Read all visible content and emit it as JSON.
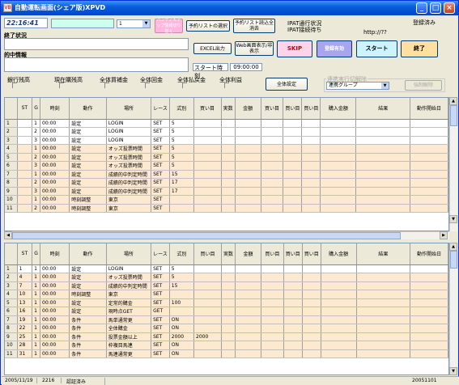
{
  "window": {
    "title": "自動運転画面(シェア版)XPVD",
    "icon": "app-icon",
    "buttons": [
      "minimize",
      "maximize",
      "close"
    ]
  },
  "top": {
    "time": "22:16:41",
    "end_status_label": "終了状況",
    "race_info_label": "的中情報",
    "combo_value": "1",
    "disabled_button": "ハンディキャップ情報切り替え",
    "select_list_button": "予約リストの選択",
    "reserve_list_button": "予約リスト読込全消去",
    "ipat_status_label": "IPAT通行状況",
    "ipat_connect_label": "IPAT接続待ち",
    "http_value": "http://??",
    "registered_label": "登録済み",
    "excel_button": "EXCEL出力",
    "web_button": "Web画面表示/非表示",
    "skip_button": "SKIP",
    "shoukai_button": "登録有効",
    "start_button": "スタート",
    "end_button": "終了",
    "start_time_label": "スタート時刻",
    "start_time_value": "09:00:00"
  },
  "options": {
    "labels": [
      "銀行残高",
      "現在購残高",
      "全体買補金",
      "全体回金",
      "全体払戻金",
      "全体利益"
    ],
    "all_settings_button": "全体設定",
    "group_title": "連携実行切解除",
    "group_combo": "連携グループ",
    "cancel_button": "強制解除"
  },
  "grid_headers": [
    "",
    "ST",
    "G",
    "時刻",
    "動作",
    "場所",
    "レース",
    "式別",
    "買い目",
    "実数",
    "金額",
    "買い目",
    "買い目",
    "買い目",
    "購入金額",
    "結果",
    "動作開始日"
  ],
  "grid1_rows": [
    {
      "n": "1",
      "st": "",
      "g": "1",
      "time": "00:00",
      "act": "設定",
      "place": "LOGIN",
      "race": "SET",
      "kind": "5",
      "c": 0
    },
    {
      "n": "2",
      "st": "",
      "g": "2",
      "time": "00:00",
      "act": "設定",
      "place": "LOGIN",
      "race": "SET",
      "kind": "5",
      "c": 0
    },
    {
      "n": "3",
      "st": "",
      "g": "3",
      "time": "00:00",
      "act": "設定",
      "place": "LOGIN",
      "race": "SET",
      "kind": "5",
      "c": 0
    },
    {
      "n": "4",
      "st": "",
      "g": "1",
      "time": "00:00",
      "act": "設定",
      "place": "オッズ投票時間",
      "race": "SET",
      "kind": "5",
      "c": 1
    },
    {
      "n": "5",
      "st": "",
      "g": "2",
      "time": "00:00",
      "act": "設定",
      "place": "オッズ投票時間",
      "race": "SET",
      "kind": "5",
      "c": 1
    },
    {
      "n": "6",
      "st": "",
      "g": "3",
      "time": "00:00",
      "act": "設定",
      "place": "オッズ投票時間",
      "race": "SET",
      "kind": "5",
      "c": 1
    },
    {
      "n": "7",
      "st": "",
      "g": "1",
      "time": "00:00",
      "act": "設定",
      "place": "成績的中判定時間",
      "race": "SET",
      "kind": "15",
      "c": 1
    },
    {
      "n": "8",
      "st": "",
      "g": "2",
      "time": "00:00",
      "act": "設定",
      "place": "成績的中判定時間",
      "race": "SET",
      "kind": "17",
      "c": 1
    },
    {
      "n": "9",
      "st": "",
      "g": "3",
      "time": "00:00",
      "act": "設定",
      "place": "成績的中判定時間",
      "race": "SET",
      "kind": "17",
      "c": 1
    },
    {
      "n": "10",
      "st": "",
      "g": "1",
      "time": "00:00",
      "act": "時刻調整",
      "place": "東京",
      "race": "SET",
      "kind": "",
      "c": 1
    },
    {
      "n": "11",
      "st": "",
      "g": "2",
      "time": "00:00",
      "act": "時刻調整",
      "place": "東京",
      "race": "SET",
      "kind": "",
      "c": 1
    }
  ],
  "grid2_rows": [
    {
      "n": "1",
      "st": "1",
      "g": "1",
      "time": "00:00",
      "act": "設定",
      "place": "LOGIN",
      "race": "SET",
      "kind": "5",
      "buy": "",
      "c": 0
    },
    {
      "n": "2",
      "st": "4",
      "g": "1",
      "time": "00:00",
      "act": "設定",
      "place": "オッズ投票時間",
      "race": "SET",
      "kind": "5",
      "buy": "",
      "c": 1
    },
    {
      "n": "3",
      "st": "7",
      "g": "1",
      "time": "00:00",
      "act": "設定",
      "place": "成績的中判定時間",
      "race": "SET",
      "kind": "15",
      "buy": "",
      "c": 1
    },
    {
      "n": "4",
      "st": "10",
      "g": "1",
      "time": "00:00",
      "act": "時刻調整",
      "place": "東京",
      "race": "SET",
      "kind": "",
      "buy": "",
      "c": 1
    },
    {
      "n": "5",
      "st": "13",
      "g": "1",
      "time": "00:00",
      "act": "設定",
      "place": "定常的購金",
      "race": "SET",
      "kind": "100",
      "buy": "",
      "c": 1
    },
    {
      "n": "6",
      "st": "16",
      "g": "1",
      "time": "00:00",
      "act": "設定",
      "place": "現時点GET",
      "race": "GET",
      "kind": "",
      "buy": "",
      "c": 1
    },
    {
      "n": "7",
      "st": "19",
      "g": "1",
      "time": "00:00",
      "act": "条件",
      "place": "馬単通常更",
      "race": "SET",
      "kind": "ON",
      "buy": "",
      "c": 1
    },
    {
      "n": "8",
      "st": "22",
      "g": "1",
      "time": "00:00",
      "act": "条件",
      "place": "全体購金",
      "race": "SET",
      "kind": "ON",
      "buy": "",
      "c": 1
    },
    {
      "n": "9",
      "st": "25",
      "g": "1",
      "time": "00:00",
      "act": "条件",
      "place": "投票金額以上",
      "race": "SET",
      "kind": "2000",
      "buy": "2000",
      "c": 1
    },
    {
      "n": "10",
      "st": "28",
      "g": "1",
      "time": "00:00",
      "act": "条件",
      "place": "枠複目馬連",
      "race": "SET",
      "kind": "ON",
      "buy": "",
      "c": 1
    },
    {
      "n": "11",
      "st": "31",
      "g": "1",
      "time": "00:00",
      "act": "条件",
      "place": "馬連通常更",
      "race": "SET",
      "kind": "ON",
      "buy": "",
      "c": 1
    }
  ],
  "status": {
    "date": "2005/11/19",
    "code": "2216",
    "state": "認証済み",
    "right": "20051101"
  }
}
